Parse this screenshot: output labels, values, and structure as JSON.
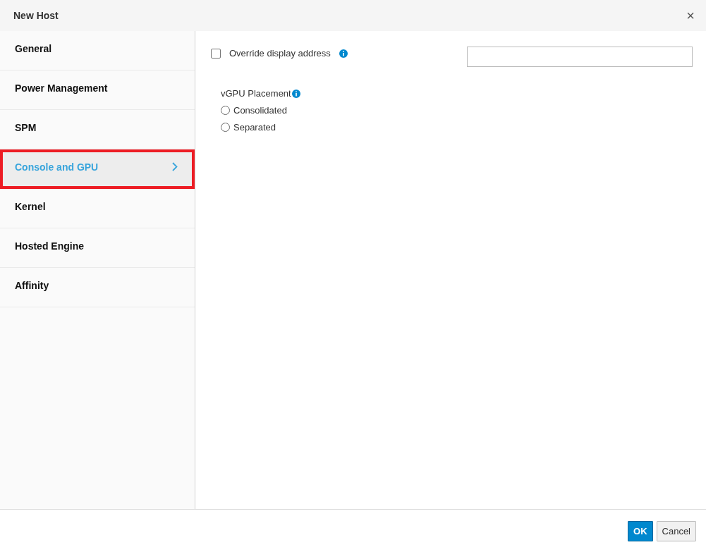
{
  "window": {
    "title": "New Host",
    "close": "×"
  },
  "sidebar": {
    "items": [
      {
        "label": "General",
        "selected": false,
        "highlighted": false
      },
      {
        "label": "Power Management",
        "selected": false,
        "highlighted": false
      },
      {
        "label": "SPM",
        "selected": false,
        "highlighted": false
      },
      {
        "label": "Console and GPU",
        "selected": true,
        "highlighted": true
      },
      {
        "label": "Kernel",
        "selected": false,
        "highlighted": false
      },
      {
        "label": "Hosted Engine",
        "selected": false,
        "highlighted": false
      },
      {
        "label": "Affinity",
        "selected": false,
        "highlighted": false
      }
    ]
  },
  "override": {
    "label": "Override display address",
    "checked": false
  },
  "vgpu": {
    "label": "vGPU Placement",
    "options": [
      {
        "label": "Consolidated",
        "selected": false
      },
      {
        "label": "Separated",
        "selected": false
      }
    ]
  },
  "buttons": [
    {
      "label": "OK",
      "kind": "primary"
    },
    {
      "label": "Cancel",
      "kind": "default"
    }
  ]
}
